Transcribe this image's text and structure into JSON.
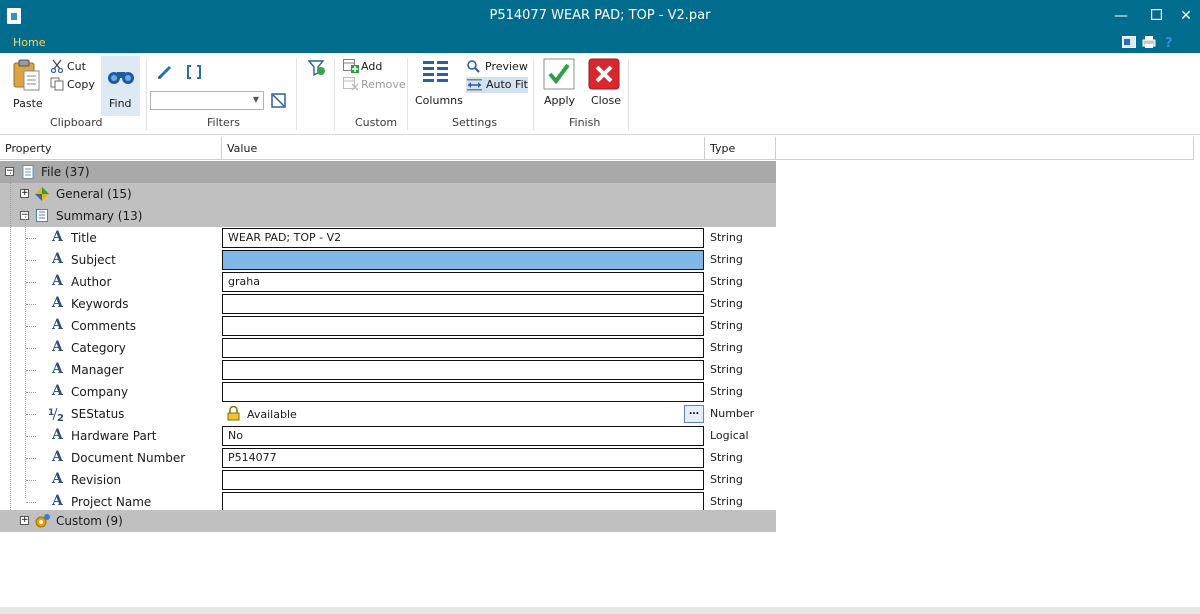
{
  "window": {
    "title": "P514077  WEAR PAD; TOP - V2.par"
  },
  "ribbon": {
    "tab": "Home",
    "clipboard": {
      "paste": "Paste",
      "cut": "Cut",
      "copy": "Copy",
      "group": "Clipboard"
    },
    "find": {
      "label": "Find"
    },
    "filters": {
      "group": "Filters",
      "dropdown_value": ""
    },
    "custom": {
      "add": "Add",
      "remove": "Remove",
      "group": "Custom"
    },
    "settings": {
      "columns": "Columns",
      "preview": "Preview",
      "autofit": "Auto Fit",
      "group": "Settings"
    },
    "finish": {
      "apply": "Apply",
      "close": "Close",
      "group": "Finish"
    }
  },
  "grid": {
    "columns": {
      "property": "Property",
      "value": "Value",
      "type": "Type"
    },
    "file_group": "File (37)",
    "general_group": "General (15)",
    "summary_group": "Summary (13)",
    "custom_group": "Custom (9)",
    "rows": [
      {
        "name": "Title",
        "value": "WEAR PAD; TOP - V2",
        "type": "String"
      },
      {
        "name": "Subject",
        "value": "",
        "type": "String"
      },
      {
        "name": "Author",
        "value": "graha",
        "type": "String"
      },
      {
        "name": "Keywords",
        "value": "",
        "type": "String"
      },
      {
        "name": "Comments",
        "value": "",
        "type": "String"
      },
      {
        "name": "Category",
        "value": "",
        "type": "String"
      },
      {
        "name": "Manager",
        "value": "",
        "type": "String"
      },
      {
        "name": "Company",
        "value": "",
        "type": "String"
      },
      {
        "name": "SEStatus",
        "value": "Available",
        "type": "Number"
      },
      {
        "name": "Hardware Part",
        "value": "No",
        "type": "Logical"
      },
      {
        "name": "Document Number",
        "value": "P514077",
        "type": "String"
      },
      {
        "name": "Revision",
        "value": "",
        "type": "String"
      },
      {
        "name": "Project Name",
        "value": "",
        "type": "String"
      }
    ]
  },
  "colors": {
    "titlebar": "#006c8e",
    "tab_active": "#ffd65a",
    "selected_value": "#7fb7e8",
    "group_row": "#c0c0c0"
  }
}
